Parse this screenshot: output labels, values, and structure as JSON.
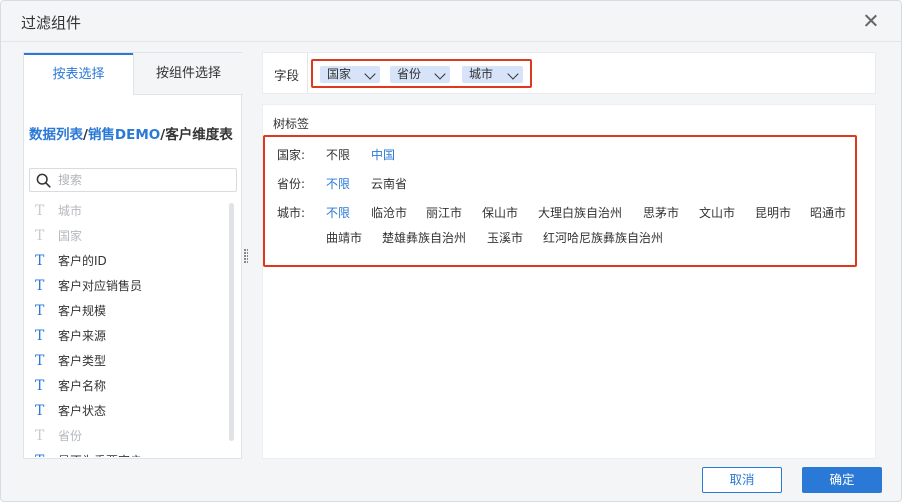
{
  "dialog": {
    "title": "过滤组件",
    "close_icon": "close-icon"
  },
  "left_panel": {
    "tabs": [
      {
        "label": "按表选择",
        "active": true
      },
      {
        "label": "按组件选择",
        "active": false
      }
    ],
    "breadcrumb": {
      "part1": "数据列表",
      "sep1": "/",
      "part2": "销售DEMO",
      "sep2": "/",
      "current": "客户维度表"
    },
    "search": {
      "placeholder": "搜索",
      "value": "",
      "icon": "search-icon"
    },
    "fields": [
      {
        "label": "城市",
        "icon": "T",
        "enabled": false
      },
      {
        "label": "国家",
        "icon": "T",
        "enabled": false
      },
      {
        "label": "客户的ID",
        "icon": "T",
        "enabled": true
      },
      {
        "label": "客户对应销售员",
        "icon": "T",
        "enabled": true
      },
      {
        "label": "客户规模",
        "icon": "T",
        "enabled": true
      },
      {
        "label": "客户来源",
        "icon": "T",
        "enabled": true
      },
      {
        "label": "客户类型",
        "icon": "T",
        "enabled": true
      },
      {
        "label": "客户名称",
        "icon": "T",
        "enabled": true
      },
      {
        "label": "客户状态",
        "icon": "T",
        "enabled": true
      },
      {
        "label": "省份",
        "icon": "T",
        "enabled": false
      },
      {
        "label": "是否为重要客户",
        "icon": "T",
        "enabled": true
      }
    ]
  },
  "field_bar": {
    "label": "字段",
    "chips": [
      "国家",
      "省份",
      "城市"
    ]
  },
  "preview": {
    "title": "树标签",
    "rows": [
      {
        "label": "国家:",
        "options": [
          {
            "text": "不限",
            "selected": false
          },
          {
            "text": "中国",
            "selected": true
          }
        ]
      },
      {
        "label": "省份:",
        "options": [
          {
            "text": "不限",
            "selected": true
          },
          {
            "text": "云南省",
            "selected": false
          }
        ]
      },
      {
        "label": "城市:",
        "options": [
          {
            "text": "不限",
            "selected": true
          },
          {
            "text": "临沧市",
            "selected": false
          },
          {
            "text": "丽江市",
            "selected": false
          },
          {
            "text": "保山市",
            "selected": false
          },
          {
            "text": "大理白族自治州",
            "selected": false
          },
          {
            "text": "思茅市",
            "selected": false
          },
          {
            "text": "文山市",
            "selected": false
          },
          {
            "text": "昆明市",
            "selected": false
          },
          {
            "text": "昭通市",
            "selected": false
          },
          {
            "text": "曲靖市",
            "selected": false
          },
          {
            "text": "楚雄彝族自治州",
            "selected": false
          },
          {
            "text": "玉溪市",
            "selected": false
          },
          {
            "text": "红河哈尼族彝族自治州",
            "selected": false
          }
        ]
      }
    ]
  },
  "footer": {
    "cancel_label": "取消",
    "ok_label": "确定"
  },
  "colors": {
    "accent": "#2b79d6",
    "highlight_border": "#e0381f",
    "chip_bg": "#d6e3f8"
  }
}
